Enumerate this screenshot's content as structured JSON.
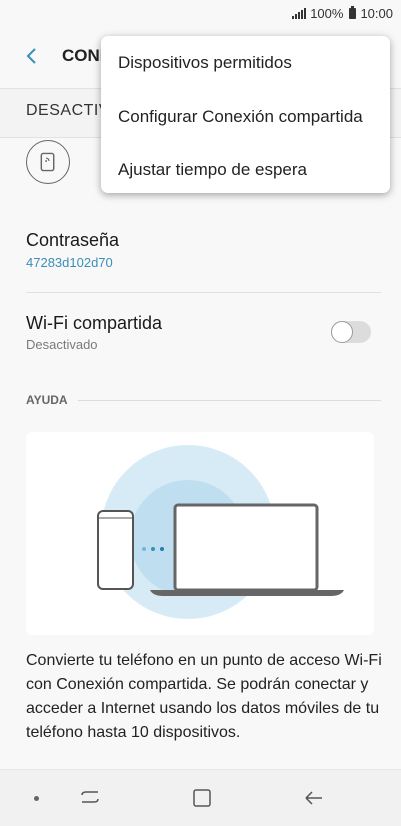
{
  "status_bar": {
    "battery": "100%",
    "time": "10:00"
  },
  "app_bar": {
    "title": "CONI"
  },
  "switch_bar": {
    "label": "DESACTIV"
  },
  "password": {
    "title": "Contraseña",
    "value": "47283d102d70"
  },
  "wifi_shared": {
    "title": "Wi-Fi compartida",
    "status": "Desactivado",
    "enabled": false
  },
  "help": {
    "label": "AYUDA",
    "description": "Convierte tu teléfono en un punto de acceso Wi-Fi con Conexión compartida. Se podrán conectar y acceder a Internet usando los datos móviles de tu teléfono hasta 10 dispositivos."
  },
  "overflow_menu": {
    "items": [
      {
        "label": "Dispositivos permitidos"
      },
      {
        "label": "Configurar Conexión compartida"
      },
      {
        "label": "Ajustar tiempo de espera"
      }
    ]
  },
  "colors": {
    "accent": "#3a8fb7",
    "illustration_circle": "#d7ebf6"
  },
  "icons": [
    "signal-icon",
    "battery-icon",
    "back-icon",
    "router-icon",
    "phone-icon",
    "laptop-icon",
    "recents-icon",
    "home-icon",
    "back-nav-icon"
  ]
}
